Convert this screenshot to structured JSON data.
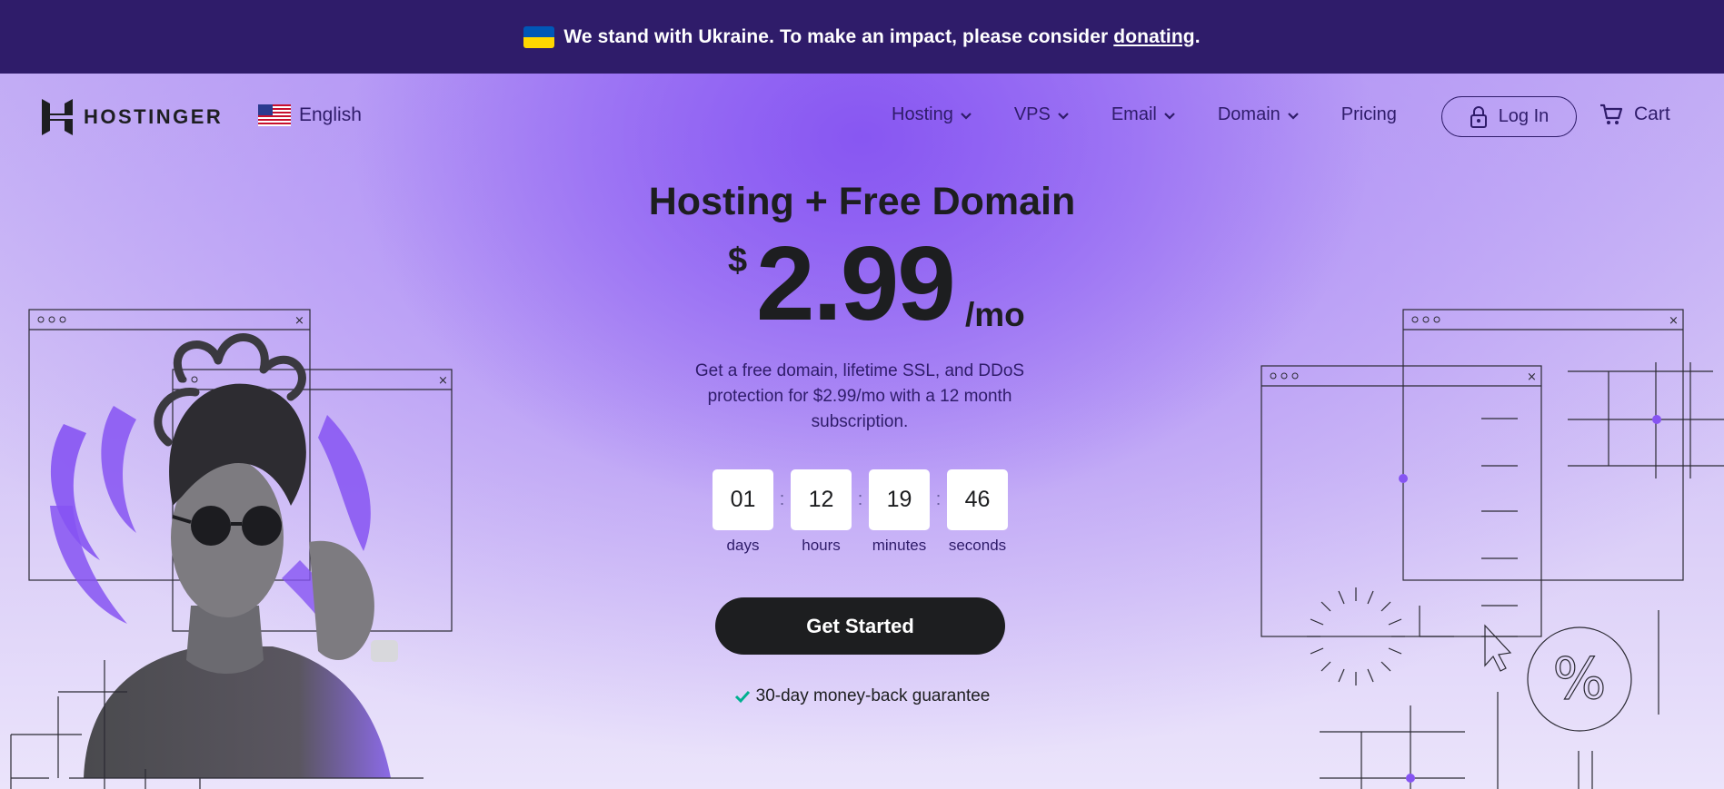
{
  "banner": {
    "text": "We stand with Ukraine. To make an impact, please consider",
    "link": "donating",
    "end": ".",
    "flag_colors": [
      "#0057b7",
      "#ffd700"
    ]
  },
  "nav": {
    "brand": "HOSTINGER",
    "language": "English",
    "menu": [
      {
        "label": "Hosting",
        "has_dropdown": true
      },
      {
        "label": "VPS",
        "has_dropdown": true
      },
      {
        "label": "Email",
        "has_dropdown": true
      },
      {
        "label": "Domain",
        "has_dropdown": true
      },
      {
        "label": "Pricing",
        "has_dropdown": false
      }
    ],
    "login": "Log In",
    "cart": "Cart"
  },
  "hero": {
    "headline": "Hosting + Free Domain",
    "currency": "$",
    "price": "2.99",
    "period": "/mo",
    "description": "Get a free domain, lifetime SSL, and DDoS protection for $2.99/mo with a 12 month subscription.",
    "countdown": [
      {
        "value": "01",
        "label": "days"
      },
      {
        "value": "12",
        "label": "hours"
      },
      {
        "value": "19",
        "label": "minutes"
      },
      {
        "value": "46",
        "label": "seconds"
      }
    ],
    "separator": ":",
    "cta": "Get Started",
    "guarantee": "30-day money-back guarantee"
  },
  "illustration": {
    "percent_symbol": "%"
  },
  "colors": {
    "banner_bg": "#2f1c6a",
    "accent_purple": "#8654f2",
    "text_dark": "#1d1e20",
    "cta_bg": "#1d1e20",
    "check_green": "#00b090"
  },
  "icons": [
    "ukraine-flag-icon",
    "hostinger-logo-icon",
    "us-flag-icon",
    "chevron-down-icon",
    "lock-icon",
    "cart-icon",
    "check-icon",
    "cursor-icon"
  ]
}
